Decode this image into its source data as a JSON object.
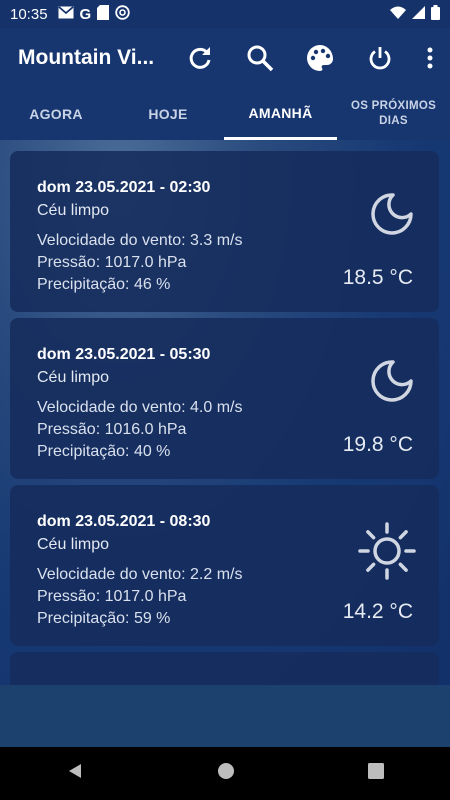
{
  "status_bar": {
    "time": "10:35",
    "left_icons": [
      "gmail-icon",
      "google-icon",
      "sd-card-icon",
      "at-sign-icon"
    ],
    "right_icons": [
      "wifi-icon",
      "signal-icon",
      "battery-icon"
    ]
  },
  "app_bar": {
    "title": "Mountain Vi...",
    "actions": [
      "refresh-icon",
      "search-icon",
      "palette-icon",
      "power-icon",
      "more-vert-icon"
    ]
  },
  "tabs": [
    {
      "label": "AGORA"
    },
    {
      "label": "HOJE"
    },
    {
      "label": "AMANHÃ",
      "active": true
    },
    {
      "label": "OS PRÓXIMOS DIAS"
    }
  ],
  "forecast": [
    {
      "date": "dom 23.05.2021 - 02:30",
      "description": "Céu limpo",
      "wind": "Velocidade do vento: 3.3 m/s",
      "pressure": "Pressão: 1017.0 hPa",
      "precipitation": "Precipitação: 46 %",
      "temperature": "18.5 °C",
      "icon": "moon-icon"
    },
    {
      "date": "dom 23.05.2021 - 05:30",
      "description": "Céu limpo",
      "wind": "Velocidade do vento: 4.0 m/s",
      "pressure": "Pressão: 1016.0 hPa",
      "precipitation": "Precipitação: 40 %",
      "temperature": "19.8 °C",
      "icon": "moon-icon"
    },
    {
      "date": "dom 23.05.2021 - 08:30",
      "description": "Céu limpo",
      "wind": "Velocidade do vento: 2.2 m/s",
      "pressure": "Pressão: 1017.0 hPa",
      "precipitation": "Precipitação: 59 %",
      "temperature": "14.2 °C",
      "icon": "sun-icon"
    }
  ],
  "nav_bar": {
    "buttons": [
      "back-icon",
      "home-icon",
      "recents-icon"
    ]
  }
}
